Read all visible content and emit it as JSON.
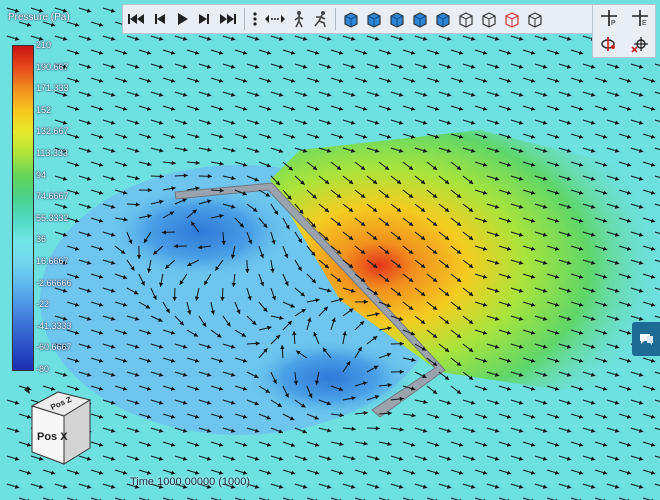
{
  "legend": {
    "title": "Pressure (Pa)",
    "ticks": [
      "210",
      "190.667",
      "171.333",
      "152",
      "132.667",
      "113.333",
      "94",
      "74.6667",
      "55.3332",
      "36",
      "16.6667",
      "-2.66666",
      "-22",
      "-41.3333",
      "-60.6667",
      "-80"
    ],
    "gradient": [
      "#c81414",
      "#e54a1a",
      "#f08f1e",
      "#f6c81e",
      "#e7ea2a",
      "#aee43a",
      "#66d45a",
      "#49d28a",
      "#51d9c2",
      "#6fe6e6",
      "#73d7ee",
      "#5fb9ec",
      "#4c94e4",
      "#3a6fd6",
      "#2a4ec6",
      "#1c2fb0"
    ]
  },
  "time": {
    "label": "Time 1000.00000 (1000)"
  },
  "orientation": {
    "top": "Pos Z",
    "front": "Pos X"
  },
  "toolbar": {
    "playback": [
      "skip-to-start-icon",
      "step-back-icon",
      "play-icon",
      "step-forward-icon",
      "skip-to-end-icon"
    ],
    "tools": [
      "more-menu-icon",
      "pan-arrows-icon",
      "walk-mode-icon",
      "run-mode-icon"
    ],
    "views": [
      "view-solid-front-icon",
      "view-solid-side-icon",
      "view-solid-iso-icon",
      "view-solid-top-icon",
      "view-solid-back-icon",
      "view-wire-iso-icon",
      "view-wire-front-icon",
      "view-wire-red-icon",
      "view-wire-back-icon"
    ],
    "side": [
      "probe-plus-icon",
      "probe-edge-icon",
      "rotate-axis-icon",
      "target-remove-icon"
    ]
  },
  "colors": {
    "background": "#6fe0e0",
    "arrow": "#101418",
    "wall": "#9aa3ad",
    "chat": "#1e6b96"
  }
}
